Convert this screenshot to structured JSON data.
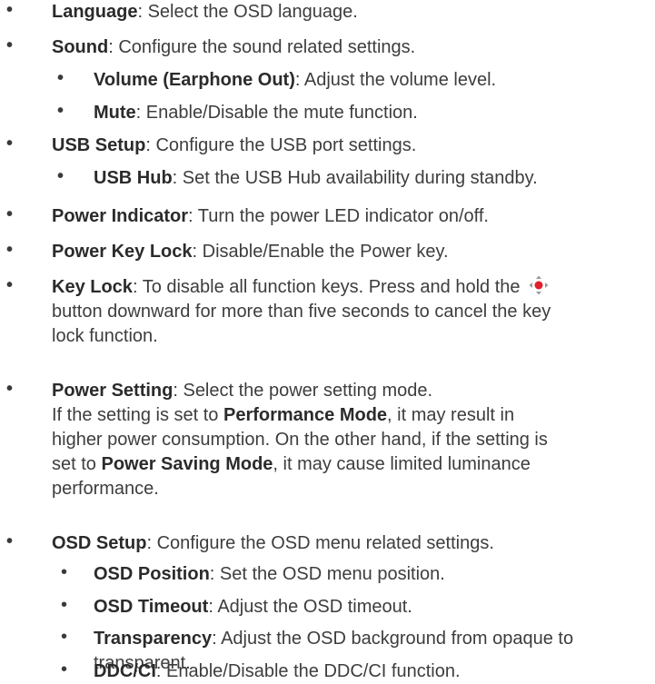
{
  "items": [
    {
      "term": "Language",
      "desc": ": Select the OSD language."
    },
    {
      "term": "Sound",
      "desc": ": Configure the sound related settings."
    },
    {
      "term": "Volume (Earphone Out)",
      "desc": ": Adjust the volume level."
    },
    {
      "term": "Mute",
      "desc": ": Enable/Disable the mute function."
    },
    {
      "term": "USB Setup",
      "desc": ": Configure the USB port settings."
    },
    {
      "term": "USB Hub",
      "desc": ": Set the USB Hub availability during standby."
    },
    {
      "term": "Power Indicator",
      "desc": ": Turn the power LED indicator on/off."
    },
    {
      "term": "Power Key Lock",
      "desc": ": Disable/Enable the Power key."
    },
    {
      "term": "Key Lock",
      "desc1": ": To disable all function keys. Press and hold the",
      "line2": "button downward for more than five seconds to cancel the key",
      "line3": "lock function."
    },
    {
      "term": "Power Setting",
      "desc": ": Select the power setting mode.",
      "p1": "If the setting is set to ",
      "b1": "Performance Mode",
      "p2": ", it may result in",
      "p3": "higher power consumption. On the other hand, if the setting is",
      "p4": "set to ",
      "b2": "Power Saving Mode",
      "p5": ", it may cause limited luminance",
      "p6": "performance."
    },
    {
      "term": "OSD Setup",
      "desc": ": Configure the OSD menu related settings."
    },
    {
      "term": "OSD Position",
      "desc": ": Set the OSD menu position."
    },
    {
      "term": "OSD Timeout",
      "desc": ": Adjust the OSD timeout."
    },
    {
      "term": "Transparency",
      "desc1": ": Adjust the OSD background from opaque to",
      "line2": "transparent."
    },
    {
      "term": "DDC/CI",
      "desc": ": Enable/Disable the DDC/CI function."
    }
  ],
  "bullet": "•",
  "icons": {
    "key_lock_button": "navigation-joystick-icon"
  },
  "colors": {
    "text": "#3a3a3a",
    "icon_red": "#e0202a",
    "icon_gray": "#9a9a9a"
  }
}
